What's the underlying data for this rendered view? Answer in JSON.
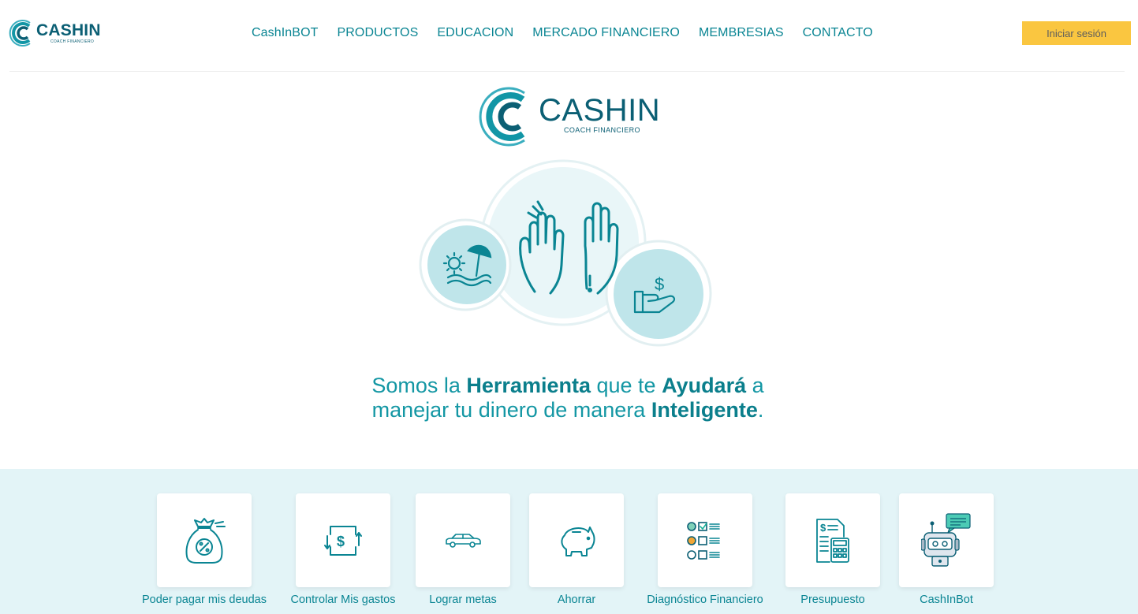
{
  "brand": {
    "name": "CASHIN",
    "subtitle": "COACH FINANCIERO"
  },
  "nav": {
    "items": [
      {
        "label": "CashInBOT"
      },
      {
        "label": "PRODUCTOS"
      },
      {
        "label": "EDUCACION"
      },
      {
        "label": "MERCADO FINANCIERO"
      },
      {
        "label": "MEMBRESIAS"
      },
      {
        "label": "CONTACTO"
      }
    ],
    "login_label": "Iniciar sesión"
  },
  "hero": {
    "tagline": {
      "p1": "Somos la ",
      "b1": "Herramienta",
      "p2": " que te ",
      "b2": "Ayudará",
      "p3": " a",
      "p4": "manejar tu dinero de manera ",
      "b3": "Inteligente",
      "p5": "."
    }
  },
  "categories": [
    {
      "label": "Poder pagar mis deudas",
      "icon": "money-bag-percent-icon"
    },
    {
      "label": "Controlar Mis gastos",
      "icon": "expense-control-icon"
    },
    {
      "label": "Lograr metas",
      "icon": "car-icon"
    },
    {
      "label": "Ahorrar",
      "icon": "piggy-bank-icon"
    },
    {
      "label": "Diagnóstico Financiero",
      "icon": "checklist-faces-icon"
    },
    {
      "label": "Presupuesto",
      "icon": "budget-calculator-icon"
    },
    {
      "label": "CashInBot",
      "icon": "robot-chat-icon"
    }
  ],
  "colors": {
    "primary": "#0a8593",
    "dark": "#0b5f74",
    "accent": "#fac640",
    "band": "#e3f4f7"
  }
}
